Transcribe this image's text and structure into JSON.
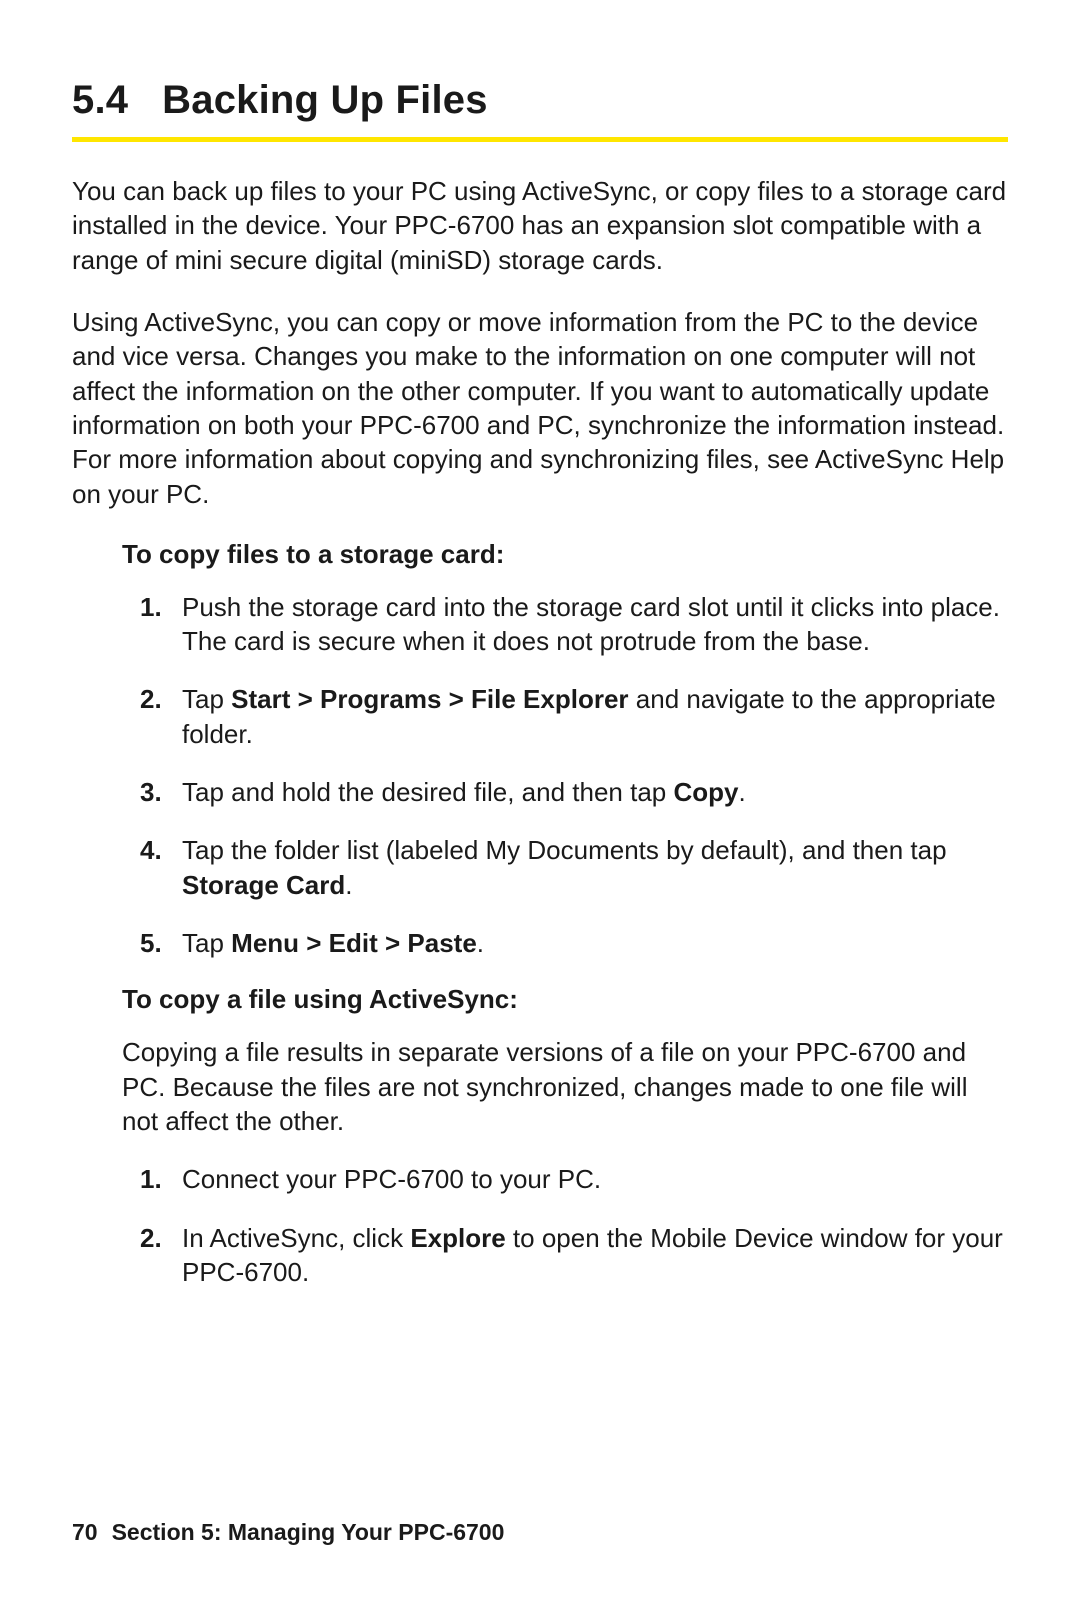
{
  "heading": {
    "number": "5.4",
    "title": "Backing Up Files"
  },
  "intro": {
    "p1": "You can back up files to your PC using ActiveSync, or copy files to a storage card installed in the device. Your PPC-6700 has an expansion slot compatible with a range of mini secure digital (miniSD) storage cards.",
    "p2": "Using ActiveSync, you can copy or move information from the PC to the device and vice versa. Changes you make to the information on one computer will not affect the information on the other computer. If you want to automatically update information on both your PPC-6700 and PC, synchronize the information instead. For more information about copying and synchronizing files, see ActiveSync Help on your PC."
  },
  "section_a": {
    "title": "To copy files to a storage card:",
    "steps": [
      {
        "n": "1.",
        "pre": "",
        "bold": "",
        "post": "Push the storage card into the storage card slot until it clicks into place. The card is secure when it does not protrude from the base."
      },
      {
        "n": "2.",
        "pre": "Tap ",
        "bold": "Start > Programs > File Explorer",
        "post": " and navigate to the appropriate folder."
      },
      {
        "n": "3.",
        "pre": "Tap and hold the desired file, and then tap ",
        "bold": "Copy",
        "post": "."
      },
      {
        "n": "4.",
        "pre": "Tap the folder list (labeled My Documents by default), and then tap ",
        "bold": "Storage Card",
        "post": "."
      },
      {
        "n": "5.",
        "pre": "Tap ",
        "bold": "Menu > Edit > Paste",
        "post": "."
      }
    ]
  },
  "section_b": {
    "title": "To copy a file using ActiveSync:",
    "body": "Copying a file results in separate versions of a file on your PPC-6700 and PC. Because the files are not synchronized, changes made to one file will not affect the other.",
    "steps": [
      {
        "n": "1.",
        "pre": "",
        "bold": "",
        "post": "Connect your PPC-6700 to your PC."
      },
      {
        "n": "2.",
        "pre": "In ActiveSync, click ",
        "bold": "Explore",
        "post": " to open the Mobile Device window for your PPC-6700."
      }
    ]
  },
  "footer": {
    "page_number": "70",
    "section_label": "Section 5: Managing Your PPC-6700"
  }
}
